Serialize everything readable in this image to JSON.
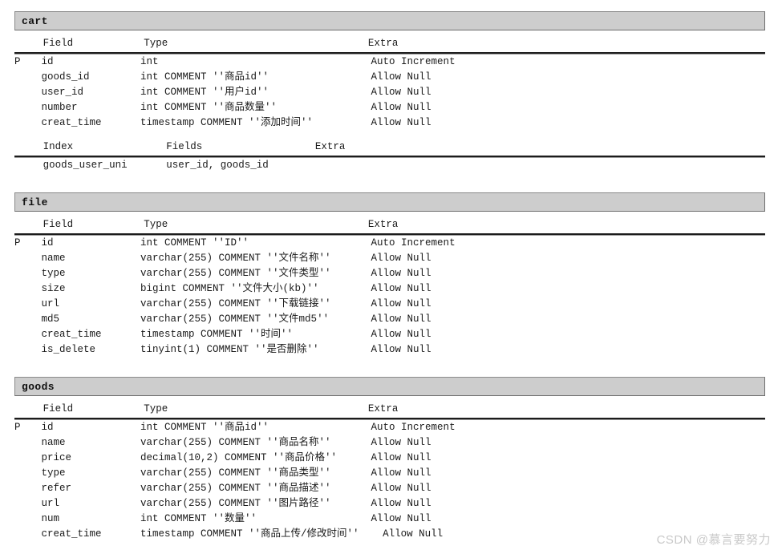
{
  "page": {
    "background": "#ffffff",
    "text_color": "#1a1a1a",
    "header_bar_color": "#cdcdcd",
    "header_border_color": "#8a8a8a",
    "rule_color": "#1c1c1c"
  },
  "watermark": {
    "text": "CSDN @慕言要努力"
  },
  "column_headers": {
    "key": "",
    "field": "Field",
    "type": "Type",
    "extra": "Extra"
  },
  "index_headers": {
    "key": "",
    "index": "Index",
    "fields": "Fields",
    "extra": "Extra"
  },
  "tables": [
    {
      "name": "cart",
      "fields": [
        {
          "key": "P",
          "field": "id",
          "type": "int",
          "extra": "Auto Increment"
        },
        {
          "key": "",
          "field": "goods_id",
          "type": "int COMMENT ''商品id''",
          "extra": "Allow Null"
        },
        {
          "key": "",
          "field": "user_id",
          "type": "int COMMENT ''用户id''",
          "extra": "Allow Null"
        },
        {
          "key": "",
          "field": "number",
          "type": "int COMMENT ''商品数量''",
          "extra": "Allow Null"
        },
        {
          "key": "",
          "field": "creat_time",
          "type": "timestamp COMMENT ''添加时间''",
          "extra": "Allow Null"
        }
      ],
      "indexes": [
        {
          "key": "",
          "name": "goods_user_uni",
          "fields": "user_id, goods_id",
          "extra": ""
        }
      ]
    },
    {
      "name": "file",
      "fields": [
        {
          "key": "P",
          "field": "id",
          "type": "int COMMENT ''ID''",
          "extra": "Auto Increment"
        },
        {
          "key": "",
          "field": "name",
          "type": "varchar(255) COMMENT ''文件名称''",
          "extra": "Allow Null"
        },
        {
          "key": "",
          "field": "type",
          "type": "varchar(255) COMMENT ''文件类型''",
          "extra": "Allow Null"
        },
        {
          "key": "",
          "field": "size",
          "type": "bigint COMMENT ''文件大小(kb)''",
          "extra": "Allow Null"
        },
        {
          "key": "",
          "field": "url",
          "type": "varchar(255) COMMENT ''下载链接''",
          "extra": "Allow Null"
        },
        {
          "key": "",
          "field": "md5",
          "type": "varchar(255) COMMENT ''文件md5''",
          "extra": "Allow Null"
        },
        {
          "key": "",
          "field": "creat_time",
          "type": "timestamp COMMENT ''时间''",
          "extra": "Allow Null"
        },
        {
          "key": "",
          "field": "is_delete",
          "type": "tinyint(1) COMMENT ''是否删除''",
          "extra": "Allow Null"
        }
      ],
      "indexes": []
    },
    {
      "name": "goods",
      "fields": [
        {
          "key": "P",
          "field": "id",
          "type": "int COMMENT ''商品id''",
          "extra": "Auto Increment"
        },
        {
          "key": "",
          "field": "name",
          "type": "varchar(255) COMMENT ''商品名称''",
          "extra": "Allow Null"
        },
        {
          "key": "",
          "field": "price",
          "type": "decimal(10,2) COMMENT ''商品价格''",
          "extra": "Allow Null"
        },
        {
          "key": "",
          "field": "type",
          "type": "varchar(255) COMMENT ''商品类型''",
          "extra": "Allow Null"
        },
        {
          "key": "",
          "field": "refer",
          "type": "varchar(255) COMMENT ''商品描述''",
          "extra": "Allow Null"
        },
        {
          "key": "",
          "field": "url",
          "type": "varchar(255) COMMENT ''图片路径''",
          "extra": "Allow Null"
        },
        {
          "key": "",
          "field": "num",
          "type": "int COMMENT ''数量''",
          "extra": "Allow Null"
        },
        {
          "key": "",
          "field": "creat_time",
          "type": "timestamp COMMENT ''商品上传/修改时间''",
          "extra": "Allow Null"
        }
      ],
      "indexes": []
    }
  ]
}
